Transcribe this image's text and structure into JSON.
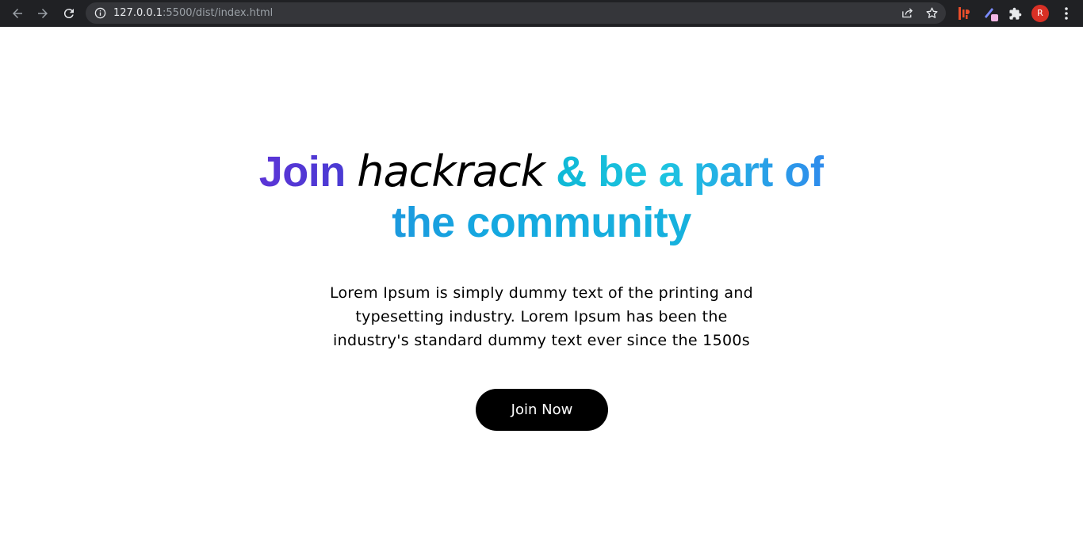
{
  "browser": {
    "url_host": "127.0.0.1",
    "url_path": ":5500/dist/index.html",
    "avatar_initial": "R",
    "icons": [
      "back-arrow-icon",
      "forward-arrow-icon",
      "reload-icon",
      "info-icon",
      "share-icon",
      "star-icon",
      "extension-icon",
      "extension-icon",
      "puzzle-icon",
      "kebab-menu-icon"
    ]
  },
  "hero": {
    "headline_join": "Join",
    "headline_brand": "hackrack",
    "headline_rest": "& be a part of",
    "headline_line2": "the community",
    "lead": "Lorem Ipsum is simply dummy text of the printing and typesetting industry. Lorem Ipsum has been the industry's standard dummy text ever since the 1500s",
    "cta_label": "Join Now"
  },
  "colors": {
    "chrome_bg": "#202124",
    "omnibox_bg": "#35363a",
    "gradient_purple": "#5b34d6",
    "gradient_cyan": "#15c3dc",
    "gradient_blue": "#2f8cec",
    "button_bg": "#000000",
    "avatar_bg": "#d93025"
  }
}
